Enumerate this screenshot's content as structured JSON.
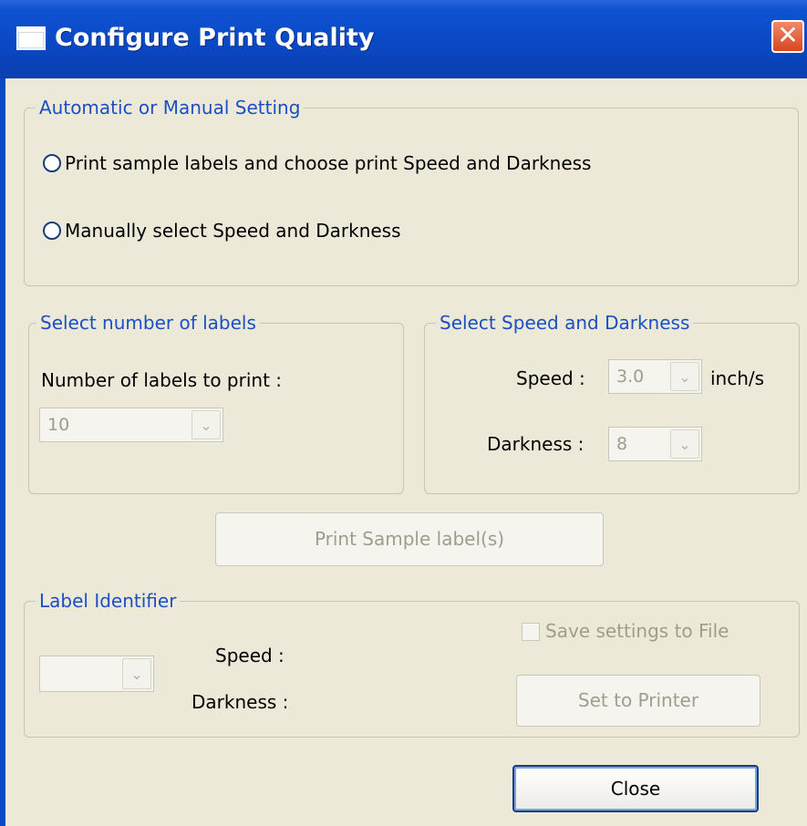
{
  "window": {
    "title": "Configure Print Quality",
    "close_glyph": "✕"
  },
  "mode_group": {
    "legend": "Automatic or Manual Setting",
    "options": [
      {
        "label": "Print sample labels and choose print Speed and Darkness"
      },
      {
        "label": "Manually select Speed and Darkness"
      }
    ]
  },
  "labels_group": {
    "legend": "Select number of labels",
    "count_label": "Number of labels to print :",
    "count_value": "10"
  },
  "speed_group": {
    "legend": "Select Speed and Darkness",
    "speed_label": "Speed :",
    "speed_value": "3.0",
    "speed_unit": "inch/s",
    "darkness_label": "Darkness :",
    "darkness_value": "8"
  },
  "print_sample_button": "Print Sample label(s)",
  "identifier_group": {
    "legend": "Label Identifier",
    "speed_label": "Speed :",
    "darkness_label": "Darkness :",
    "save_checkbox_label": "Save settings to File",
    "set_button": "Set to Printer"
  },
  "close_button": "Close",
  "icons": {
    "dropdown": "chevron-down-icon"
  }
}
